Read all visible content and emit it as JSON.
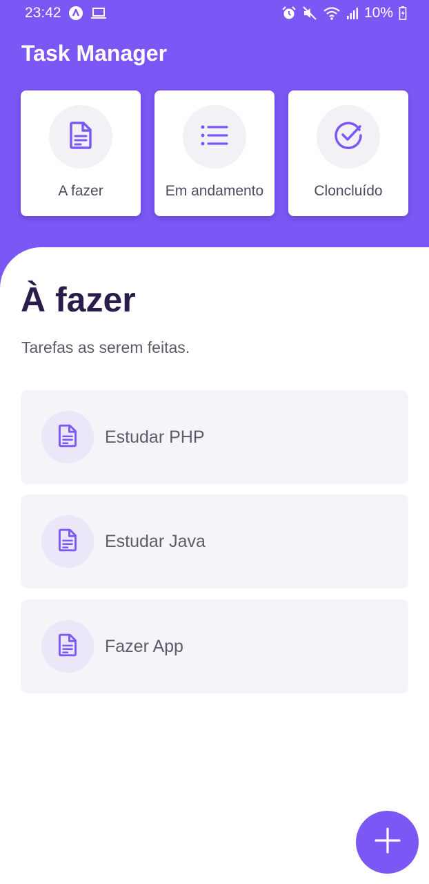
{
  "status_bar": {
    "time": "23:42",
    "battery": "10%",
    "left_icons": [
      "notification-app-icon",
      "laptop-icon"
    ],
    "right_icons": [
      "alarm-icon",
      "mute-icon",
      "wifi-icon",
      "signal-icon",
      "battery-icon"
    ]
  },
  "header": {
    "title": "Task Manager"
  },
  "categories": [
    {
      "label": "A fazer",
      "icon": "document-icon"
    },
    {
      "label": "Em andamento",
      "icon": "list-icon"
    },
    {
      "label": "Cloncluído",
      "icon": "check-circle-icon"
    }
  ],
  "section": {
    "title": "À fazer",
    "subtitle": "Tarefas as serem feitas."
  },
  "tasks": [
    {
      "label": "Estudar PHP",
      "icon": "document-icon"
    },
    {
      "label": "Estudar Java",
      "icon": "document-icon"
    },
    {
      "label": "Fazer App",
      "icon": "document-icon"
    }
  ],
  "fab": {
    "icon": "plus-icon"
  },
  "colors": {
    "primary": "#7b57f5",
    "card_bg": "#ffffff",
    "task_bg": "#f4f5f9",
    "title_text": "#2b1d4a"
  }
}
